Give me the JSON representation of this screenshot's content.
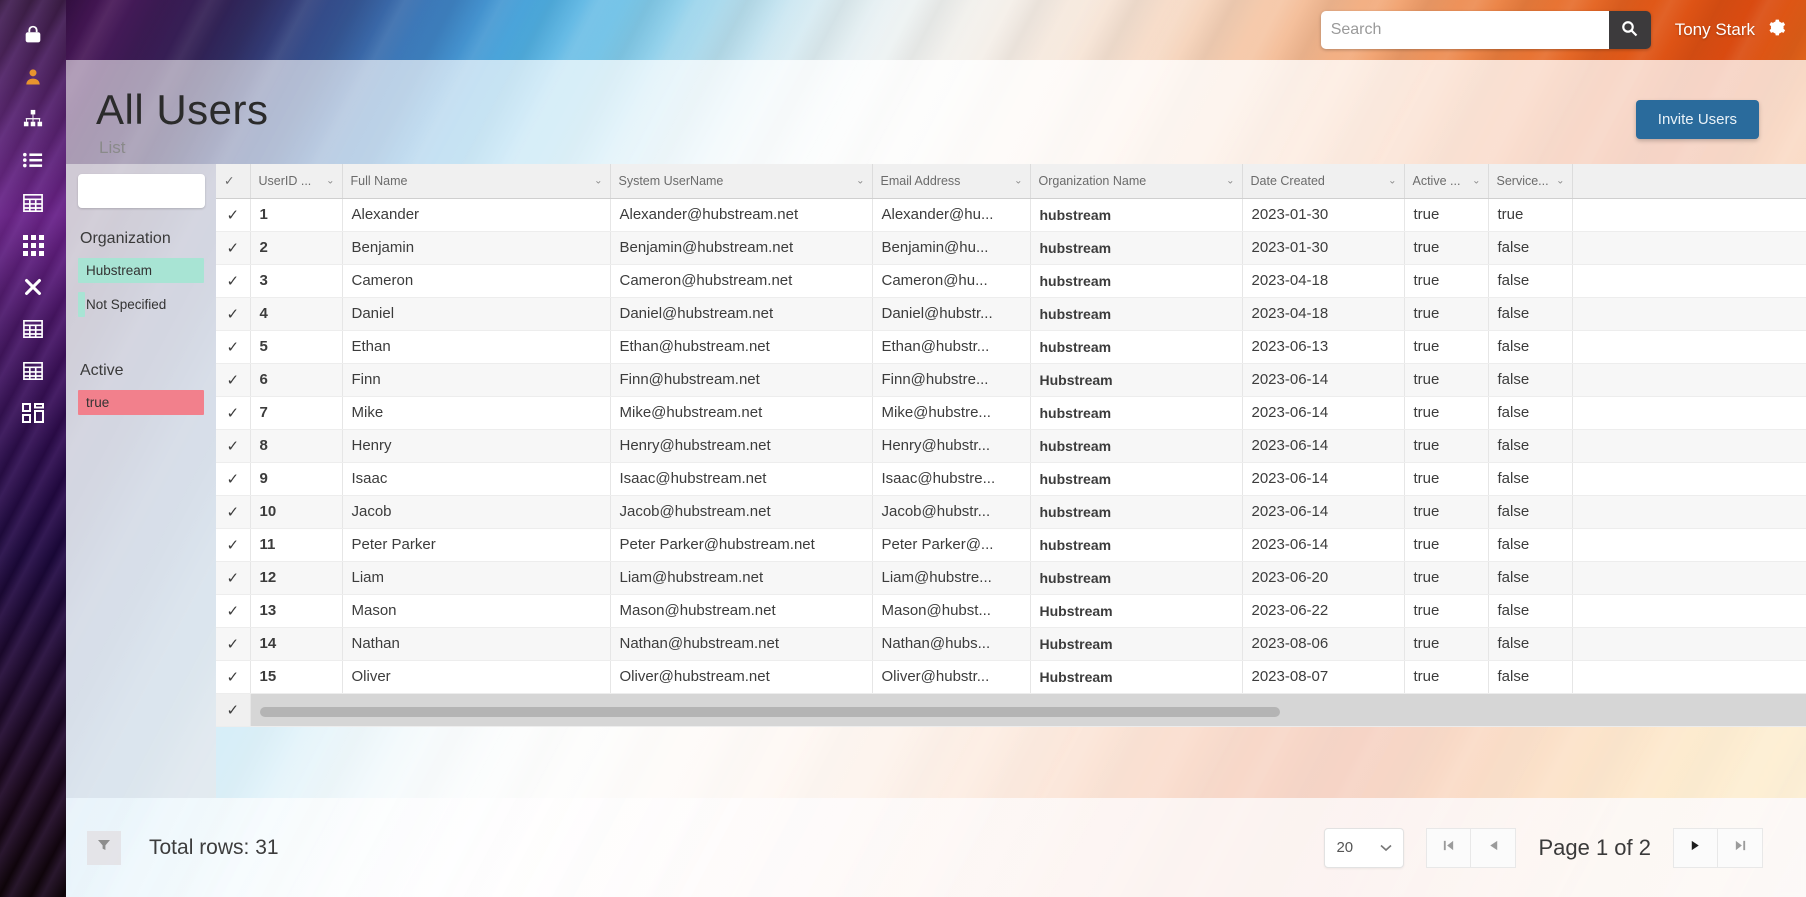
{
  "topbar": {
    "search_placeholder": "Search",
    "search_value": "",
    "search_icon": "search-icon",
    "user_name": "Tony Stark",
    "gear_icon": "gear-icon"
  },
  "header": {
    "title": "All Users",
    "subtitle": "List",
    "invite_label": "Invite Users",
    "invite_color": "#2a6b9c"
  },
  "rail": {
    "items": [
      {
        "icon": "lock-icon"
      },
      {
        "icon": "user-profile-icon"
      },
      {
        "icon": "hierarchy-icon"
      },
      {
        "icon": "list-icon"
      },
      {
        "icon": "table-icon"
      },
      {
        "icon": "grid-dots-icon"
      },
      {
        "icon": "close-x-icon"
      },
      {
        "icon": "table-icon"
      },
      {
        "icon": "table-icon"
      },
      {
        "icon": "dashboard-icon"
      }
    ]
  },
  "facets": {
    "search_value": "",
    "search_placeholder": "",
    "search_icon": "search-icon",
    "groups": [
      {
        "title": "Organization",
        "items": [
          {
            "label": "Hubstream",
            "bar_pct": 100,
            "bar_color": "#a8e4d4"
          },
          {
            "label": "Not Specified",
            "bar_pct": 7,
            "bar_color": "#a8e4d4"
          }
        ]
      },
      {
        "title": "Active",
        "items": [
          {
            "label": "true",
            "bar_pct": 100,
            "bar_color": "#f2808c"
          }
        ]
      }
    ]
  },
  "grid": {
    "columns": [
      {
        "key": "check",
        "label": "",
        "caret": false
      },
      {
        "key": "id",
        "label": "UserID ...",
        "caret": true
      },
      {
        "key": "full",
        "label": "Full Name",
        "caret": true
      },
      {
        "key": "user",
        "label": "System UserName",
        "caret": true
      },
      {
        "key": "email",
        "label": "Email Address",
        "caret": true
      },
      {
        "key": "org",
        "label": "Organization Name",
        "caret": true
      },
      {
        "key": "date",
        "label": "Date Created",
        "caret": true
      },
      {
        "key": "active",
        "label": "Active ...",
        "caret": true
      },
      {
        "key": "service",
        "label": "Service...",
        "caret": true
      },
      {
        "key": "tail",
        "label": "",
        "caret": true
      }
    ],
    "rows": [
      {
        "check": "✓",
        "id": "1",
        "full": "Alexander",
        "user": "Alexander@hubstream.net",
        "email": "Alexander@hu...",
        "org": "hubstream",
        "date": "2023-01-30",
        "active": "true",
        "service": "true",
        "tail": ""
      },
      {
        "check": "✓",
        "id": "2",
        "full": "Benjamin",
        "user": "Benjamin@hubstream.net",
        "email": "Benjamin@hu...",
        "org": "hubstream",
        "date": "2023-01-30",
        "active": "true",
        "service": "false",
        "tail": ""
      },
      {
        "check": "✓",
        "id": "3",
        "full": "Cameron",
        "user": "Cameron@hubstream.net",
        "email": "Cameron@hu...",
        "org": "hubstream",
        "date": "2023-04-18",
        "active": "true",
        "service": "false",
        "tail": ""
      },
      {
        "check": "✓",
        "id": "4",
        "full": "Daniel",
        "user": "Daniel@hubstream.net",
        "email": "Daniel@hubstr...",
        "org": "hubstream",
        "date": "2023-04-18",
        "active": "true",
        "service": "false",
        "tail": ""
      },
      {
        "check": "✓",
        "id": "5",
        "full": "Ethan",
        "user": "Ethan@hubstream.net",
        "email": "Ethan@hubstr...",
        "org": "hubstream",
        "date": "2023-06-13",
        "active": "true",
        "service": "false",
        "tail": ""
      },
      {
        "check": "✓",
        "id": "6",
        "full": "Finn",
        "user": "Finn@hubstream.net",
        "email": "Finn@hubstre...",
        "org": "Hubstream",
        "date": "2023-06-14",
        "active": "true",
        "service": "false",
        "tail": ""
      },
      {
        "check": "✓",
        "id": "7",
        "full": "Mike",
        "user": "Mike@hubstream.net",
        "email": "Mike@hubstre...",
        "org": "hubstream",
        "date": "2023-06-14",
        "active": "true",
        "service": "false",
        "tail": ""
      },
      {
        "check": "✓",
        "id": "8",
        "full": "Henry",
        "user": "Henry@hubstream.net",
        "email": "Henry@hubstr...",
        "org": "hubstream",
        "date": "2023-06-14",
        "active": "true",
        "service": "false",
        "tail": ""
      },
      {
        "check": "✓",
        "id": "9",
        "full": "Isaac",
        "user": "Isaac@hubstream.net",
        "email": "Isaac@hubstre...",
        "org": "hubstream",
        "date": "2023-06-14",
        "active": "true",
        "service": "false",
        "tail": ""
      },
      {
        "check": "✓",
        "id": "10",
        "full": "Jacob",
        "user": "Jacob@hubstream.net",
        "email": "Jacob@hubstr...",
        "org": "hubstream",
        "date": "2023-06-14",
        "active": "true",
        "service": "false",
        "tail": ""
      },
      {
        "check": "✓",
        "id": "11",
        "full": "Peter Parker",
        "user": "Peter Parker@hubstream.net",
        "email": "Peter Parker@...",
        "org": "hubstream",
        "date": "2023-06-14",
        "active": "true",
        "service": "false",
        "tail": ""
      },
      {
        "check": "✓",
        "id": "12",
        "full": "Liam",
        "user": "Liam@hubstream.net",
        "email": "Liam@hubstre...",
        "org": "hubstream",
        "date": "2023-06-20",
        "active": "true",
        "service": "false",
        "tail": ""
      },
      {
        "check": "✓",
        "id": "13",
        "full": "Mason",
        "user": "Mason@hubstream.net",
        "email": "Mason@hubst...",
        "org": "Hubstream",
        "date": "2023-06-22",
        "active": "true",
        "service": "false",
        "tail": ""
      },
      {
        "check": "✓",
        "id": "14",
        "full": "Nathan",
        "user": "Nathan@hubstream.net",
        "email": "Nathan@hubs...",
        "org": "Hubstream",
        "date": "2023-08-06",
        "active": "true",
        "service": "false",
        "tail": ""
      },
      {
        "check": "✓",
        "id": "15",
        "full": "Oliver",
        "user": "Oliver@hubstream.net",
        "email": "Oliver@hubstr...",
        "org": "Hubstream",
        "date": "2023-08-07",
        "active": "true",
        "service": "false",
        "tail": ""
      }
    ]
  },
  "footer": {
    "filter_icon": "funnel-icon",
    "total_rows": "Total rows: 31",
    "page_size": "20",
    "page_size_caret": "chevron-down-icon",
    "page_label": "Page 1 of 2",
    "buttons": {
      "first": "first-page-icon",
      "prev": "previous-page-icon",
      "next": "next-page-icon",
      "last": "last-page-icon"
    }
  }
}
